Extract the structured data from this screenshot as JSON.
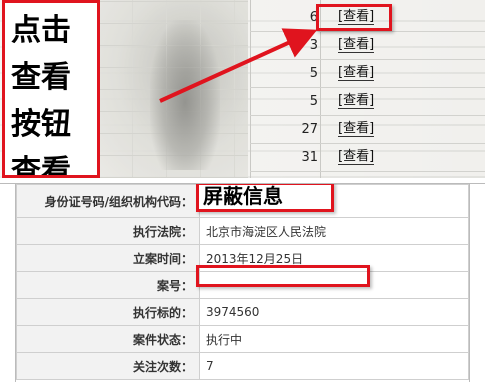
{
  "annotation": {
    "lines": [
      "点击",
      "查看",
      "按钮",
      "查看"
    ]
  },
  "list": {
    "rows": [
      {
        "count": "6",
        "view_label": "[查看]"
      },
      {
        "count": "3",
        "view_label": "[查看]"
      },
      {
        "count": "5",
        "view_label": "[查看]"
      },
      {
        "count": "5",
        "view_label": "[查看]"
      },
      {
        "count": "27",
        "view_label": "[查看]"
      },
      {
        "count": "31",
        "view_label": "[查看]"
      }
    ]
  },
  "detail": {
    "id_label": "身份证号码/组织机构代码：",
    "id_mask_text": "屏蔽信息",
    "court_label": "执行法院：",
    "court_value": "北京市海淀区人民法院",
    "filed_label": "立案时间：",
    "filed_value": "2013年12月25日",
    "case_no_label": "案号：",
    "case_no_value": "",
    "amount_label": "执行标的：",
    "amount_value": "3974560",
    "status_label": "案件状态：",
    "status_value": "执行中",
    "follow_label": "关注次数：",
    "follow_value": "7"
  },
  "colors": {
    "highlight": "#e0141e"
  }
}
